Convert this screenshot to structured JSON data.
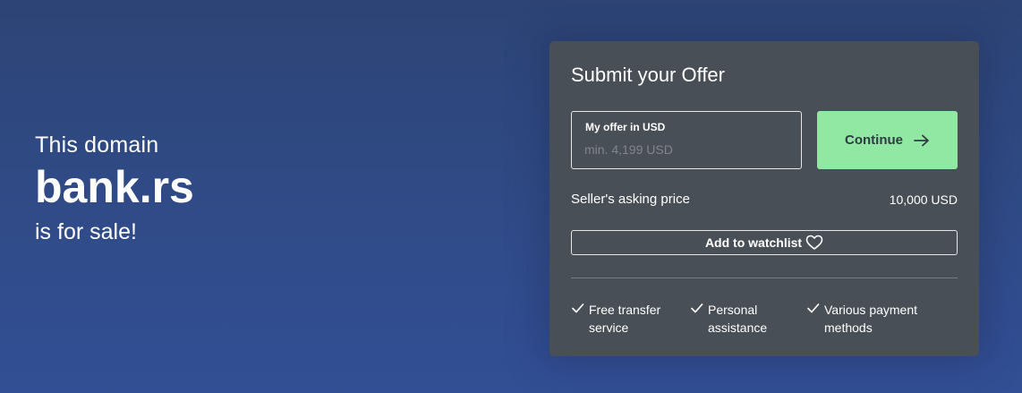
{
  "hero": {
    "pre_text": "This domain",
    "domain": "bank.rs",
    "post_text": "is for sale!"
  },
  "offer_card": {
    "title": "Submit your Offer",
    "offer_field": {
      "label": "My offer in USD",
      "placeholder": "min. 4,199 USD",
      "value": ""
    },
    "continue_button": {
      "label": "Continue",
      "icon": "arrow-right-icon"
    },
    "asking_price": {
      "label": "Seller's asking price",
      "value": "10,000 USD"
    },
    "watchlist_button": {
      "label": "Add to watchlist",
      "icon": "heart-icon"
    },
    "features": [
      {
        "icon": "check-icon",
        "text": "Free transfer\nservice"
      },
      {
        "icon": "check-icon",
        "text": "Personal\nassistance"
      },
      {
        "icon": "check-icon",
        "text": "Various payment\nmethods"
      }
    ]
  },
  "colors": {
    "background_top": "#2d4475",
    "background_bottom": "#324f95",
    "card": "#494f56",
    "continue_button": "#91e8a2",
    "text": "#ffffff"
  }
}
